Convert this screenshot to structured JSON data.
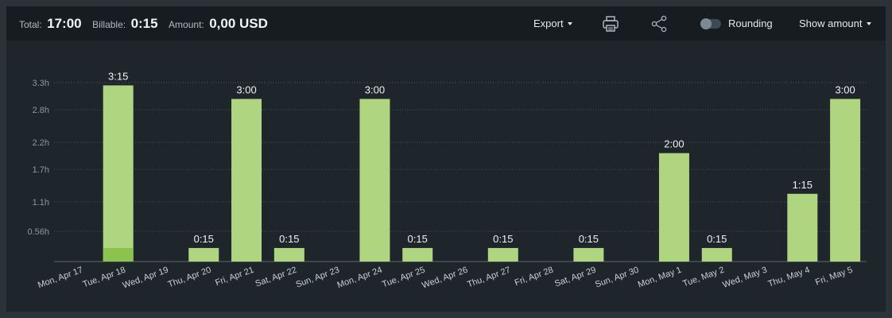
{
  "summary": {
    "total_label": "Total:",
    "total_value": "17:00",
    "billable_label": "Billable:",
    "billable_value": "0:15",
    "amount_label": "Amount:",
    "amount_value": "0,00 USD"
  },
  "toolbar": {
    "export_label": "Export",
    "print_icon": "printer-icon",
    "share_icon": "share-icon",
    "rounding_label": "Rounding",
    "rounding_on": false,
    "show_amount_label": "Show amount"
  },
  "colors": {
    "bar": "#b0d580",
    "billable": "#8cc34f",
    "grid": "#4a5359"
  },
  "chart_data": {
    "type": "bar",
    "categories": [
      "Mon, Apr 17",
      "Tue, Apr 18",
      "Wed, Apr 19",
      "Thu, Apr 20",
      "Fri, Apr 21",
      "Sat, Apr 22",
      "Sun, Apr 23",
      "Mon, Apr 24",
      "Tue, Apr 25",
      "Wed, Apr 26",
      "Thu, Apr 27",
      "Fri, Apr 28",
      "Sat, Apr 29",
      "Sun, Apr 30",
      "Mon, May 1",
      "Tue, May 2",
      "Wed, May 3",
      "Thu, May 4",
      "Fri, May 5"
    ],
    "series": [
      {
        "values": [
          0,
          3.25,
          0,
          0.25,
          3,
          0.25,
          0,
          3,
          0.25,
          0,
          0.25,
          0,
          0.25,
          0,
          2,
          0.25,
          0,
          1.25,
          3
        ]
      },
      {
        "values": [
          0,
          0.25,
          0,
          0,
          0,
          0,
          0,
          0,
          0,
          0,
          0,
          0,
          0,
          0,
          0,
          0,
          0,
          0,
          0
        ]
      }
    ],
    "bar_labels": [
      "",
      "3:15",
      "",
      "0:15",
      "3:00",
      "0:15",
      "",
      "3:00",
      "0:15",
      "",
      "0:15",
      "",
      "0:15",
      "",
      "2:00",
      "0:15",
      "",
      "1:15",
      "3:00"
    ],
    "yticks": [
      0.56,
      1.1,
      1.7,
      2.2,
      2.8,
      3.3
    ],
    "ytick_labels": [
      "0.56h",
      "1.1h",
      "1.7h",
      "2.2h",
      "2.8h",
      "3.3h"
    ],
    "ylim": [
      0,
      3.3
    ],
    "grid": true,
    "legend": "none"
  }
}
